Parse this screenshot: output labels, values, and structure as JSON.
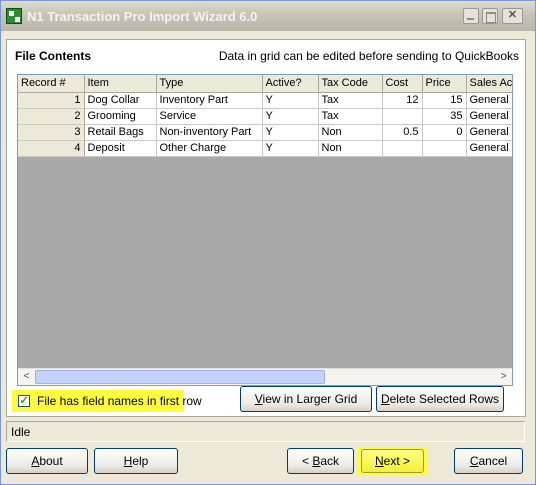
{
  "window": {
    "title": "N1 Transaction Pro Import Wizard 6.0",
    "close_glyph": "✕"
  },
  "panel": {
    "title": "File Contents",
    "note": "Data in grid can be edited before sending to QuickBooks"
  },
  "grid": {
    "columns": [
      "Record #",
      "Item",
      "Type",
      "Active?",
      "Tax Code",
      "Cost",
      "Price",
      "Sales Ac"
    ],
    "rows": [
      {
        "record": "1",
        "item": "Dog Collar",
        "type": "Inventory Part",
        "active": "Y",
        "tax_code": "Tax",
        "cost": "12",
        "price": "15",
        "sales_acct": "General S"
      },
      {
        "record": "2",
        "item": "Grooming",
        "type": "Service",
        "active": "Y",
        "tax_code": "Tax",
        "cost": "",
        "price": "35",
        "sales_acct": "General S"
      },
      {
        "record": "3",
        "item": "Retail Bags",
        "type": "Non-inventory Part",
        "active": "Y",
        "tax_code": "Non",
        "cost": "0.5",
        "price": "0",
        "sales_acct": "General S"
      },
      {
        "record": "4",
        "item": "Deposit",
        "type": "Other Charge",
        "active": "Y",
        "tax_code": "Non",
        "cost": "",
        "price": "",
        "sales_acct": "General S"
      }
    ],
    "scroll_left_glyph": "<",
    "scroll_right_glyph": ">"
  },
  "options": {
    "field_names_label": "File has field names in first row",
    "field_names_checked": true,
    "check_glyph": "✓"
  },
  "actions": {
    "view_larger_pre": "",
    "view_larger_u": "V",
    "view_larger_post": "iew in Larger Grid",
    "delete_pre": "",
    "delete_u": "D",
    "delete_post": "elete Selected Rows"
  },
  "status": {
    "text": "Idle"
  },
  "footer": {
    "about_u": "A",
    "about_post": "bout",
    "help_u": "H",
    "help_post": "elp",
    "back_pre": "< ",
    "back_u": "B",
    "back_post": "ack",
    "next_u": "N",
    "next_post": "ext >",
    "cancel_u": "C",
    "cancel_post": "ancel"
  },
  "colors": {
    "highlight": "#fffc3c",
    "title_bar": "#c6c3b7",
    "grid_empty": "#a9a9a9"
  },
  "icons": [
    "app-icon",
    "minimize-icon",
    "maximize-icon",
    "close-icon",
    "checkmark-icon",
    "scroll-left-icon",
    "scroll-right-icon"
  ]
}
